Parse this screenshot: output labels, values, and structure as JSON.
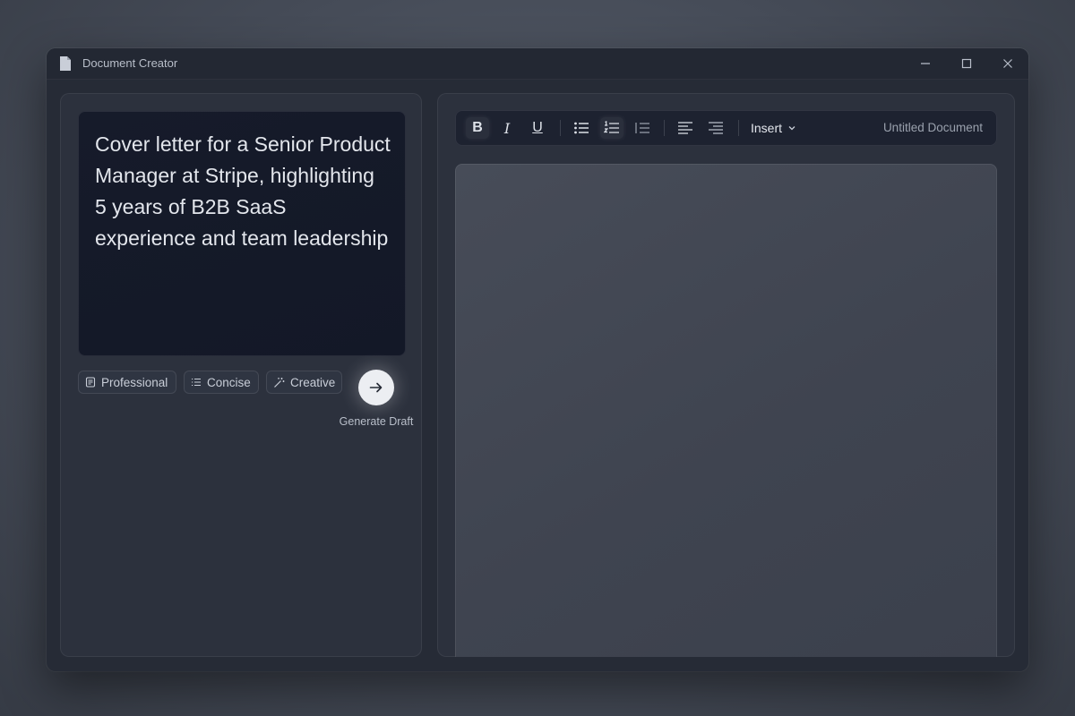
{
  "window": {
    "title": "Document Creator",
    "icons": {
      "app": "document-icon",
      "minimize": "minimize-icon",
      "maximize": "maximize-icon",
      "close": "close-icon"
    }
  },
  "prompt": {
    "text": "Cover letter for a Senior Product Manager at Stripe, highlighting 5 years of B2B SaaS experience and team leadership"
  },
  "tone_chips": [
    {
      "label": "Professional",
      "icon": "document-icon"
    },
    {
      "label": "Concise",
      "icon": "list-icon"
    },
    {
      "label": "Creative",
      "icon": "magic-wand-icon"
    }
  ],
  "generate": {
    "label": "Generate Draft",
    "icon": "arrow-right-icon"
  },
  "toolbar": {
    "bold": "B",
    "italic": "I",
    "underline": "U",
    "insert_label": "Insert",
    "document_title": "Untitled Document"
  },
  "colors": {
    "background": "#4a505c",
    "window": "#262b36",
    "panel": "#2c313d",
    "prompt_box": "#151a29",
    "canvas": "#434854",
    "accent_button": "#eceef2"
  }
}
